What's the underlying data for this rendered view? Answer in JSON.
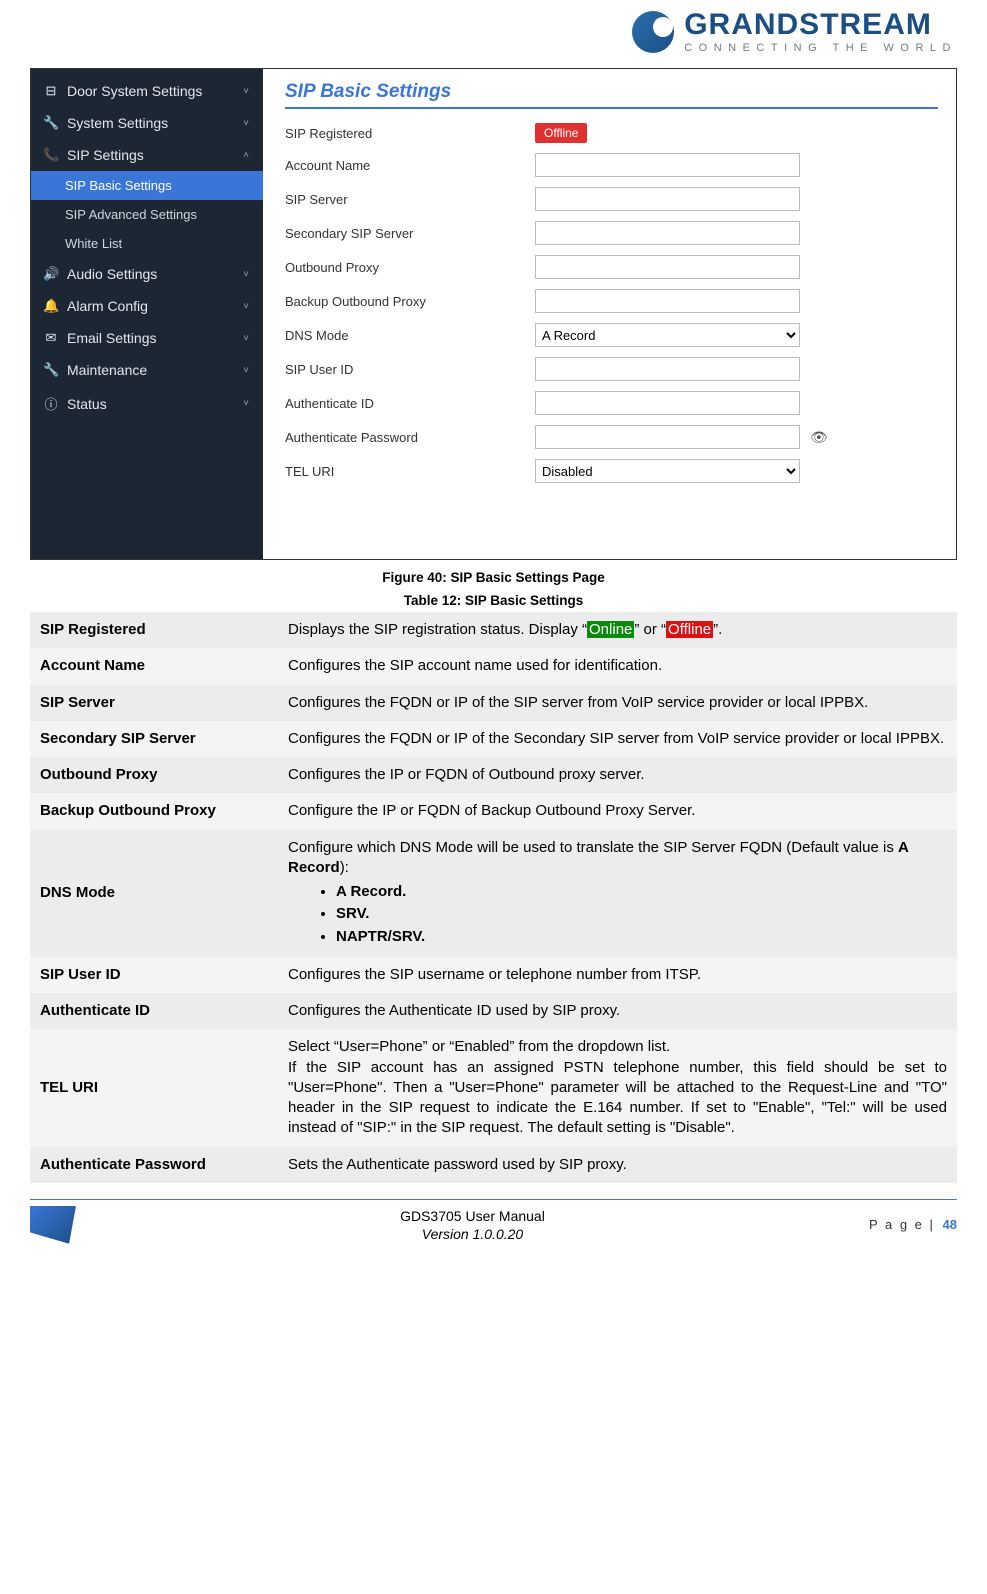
{
  "brand": {
    "name": "GRANDSTREAM",
    "tagline": "CONNECTING THE WORLD"
  },
  "sidebar": {
    "items": [
      {
        "glyph": "⊟",
        "label": "Door System Settings",
        "caret": "˅"
      },
      {
        "glyph": "🔧",
        "label": "System Settings",
        "caret": "˅"
      },
      {
        "glyph": "📞",
        "label": "SIP Settings",
        "caret": "˄"
      },
      {
        "glyph": "🔊",
        "label": "Audio Settings",
        "caret": "˅"
      },
      {
        "glyph": "🔔",
        "label": "Alarm Config",
        "caret": "˅"
      },
      {
        "glyph": "✉",
        "label": "Email Settings",
        "caret": "˅"
      },
      {
        "glyph": "🔧",
        "label": "Maintenance",
        "caret": "˅"
      },
      {
        "glyph": "ⓘ",
        "label": "Status",
        "caret": "˅"
      }
    ],
    "subs": [
      {
        "label": "SIP Basic Settings",
        "active": true
      },
      {
        "label": "SIP Advanced Settings",
        "active": false
      },
      {
        "label": "White List",
        "active": false
      }
    ]
  },
  "panel": {
    "title": "SIP Basic Settings",
    "rows": {
      "sip_registered": "SIP Registered",
      "offline": "Offline",
      "account_name": "Account Name",
      "sip_server": "SIP Server",
      "secondary_sip_server": "Secondary SIP Server",
      "outbound_proxy": "Outbound Proxy",
      "backup_outbound_proxy": "Backup Outbound Proxy",
      "dns_mode": "DNS Mode",
      "dns_mode_value": "A Record",
      "sip_user_id": "SIP User ID",
      "authenticate_id": "Authenticate ID",
      "authenticate_password": "Authenticate Password",
      "tel_uri": "TEL URI",
      "tel_uri_value": "Disabled"
    }
  },
  "captions": {
    "figure": "Figure 40: SIP Basic Settings Page",
    "table": "Table 12: SIP Basic Settings"
  },
  "table": {
    "r0": {
      "k": "SIP Registered",
      "pre": "Displays the SIP registration status. Display “",
      "online": "Online",
      "mid": "” or “",
      "offline": "Offline",
      "post": "”."
    },
    "r1": {
      "k": "Account Name",
      "v": "Configures the SIP account name used for identification."
    },
    "r2": {
      "k": "SIP Server",
      "v": "Configures the FQDN or IP of the SIP server from VoIP service provider or local IPPBX."
    },
    "r3": {
      "k": "Secondary SIP Server",
      "v": "Configures the FQDN or IP of the Secondary SIP server from VoIP service provider or local IPPBX."
    },
    "r4": {
      "k": "Outbound Proxy",
      "v": "Configures the IP or FQDN of Outbound proxy server."
    },
    "r5": {
      "k": "Backup Outbound Proxy",
      "v": "Configure the IP or FQDN of Backup Outbound Proxy Server."
    },
    "r6": {
      "k": "DNS Mode",
      "lead": "Configure which DNS Mode will be used to translate the SIP Server FQDN (Default value is ",
      "bold_default": "A Record",
      "lead_end": "):",
      "li0": "A Record.",
      "li1": "SRV.",
      "li2": "NAPTR/SRV."
    },
    "r7": {
      "k": "SIP User ID",
      "v": "Configures the SIP username or telephone number from ITSP."
    },
    "r8": {
      "k": "Authenticate ID",
      "v": "Configures the Authenticate ID used by SIP proxy."
    },
    "r9": {
      "k": "TEL URI",
      "line1": "Select “User=Phone” or “Enabled” from the dropdown list.",
      "line2": "If the SIP account has an assigned PSTN telephone number, this field should be set to \"User=Phone\". Then a \"User=Phone\" parameter will be attached to the Request-Line and \"TO\" header in the SIP request to indicate the E.164 number. If set to \"Enable\", \"Tel:\" will be used instead of \"SIP:\" in the SIP request. The default setting is \"Disable\"."
    },
    "r10": {
      "k": "Authenticate Password",
      "v": "Sets the Authenticate password used by SIP proxy."
    }
  },
  "footer": {
    "title": "GDS3705 User Manual",
    "version": "Version 1.0.0.20",
    "page_word": "P a g e",
    "page_sep": " | ",
    "page_num": "48"
  }
}
